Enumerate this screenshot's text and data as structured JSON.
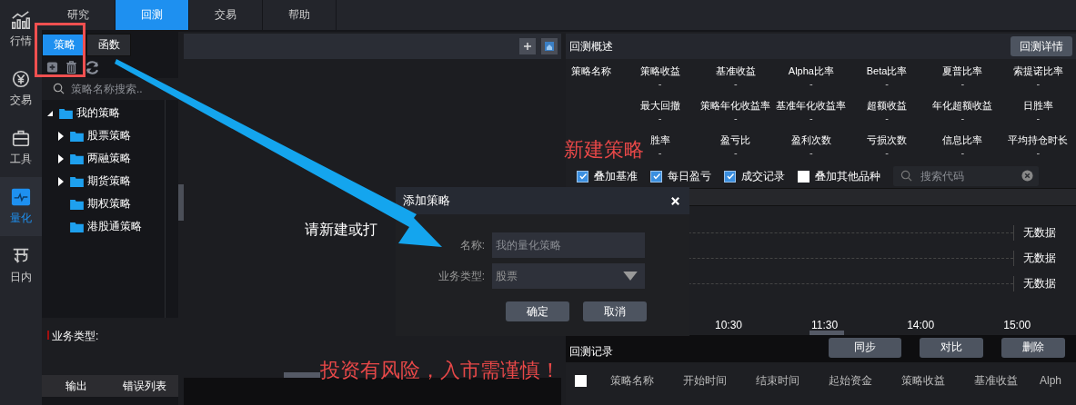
{
  "nav": [
    {
      "label": "行情",
      "selected": false
    },
    {
      "label": "交易",
      "selected": false
    },
    {
      "label": "工具",
      "selected": false
    },
    {
      "label": "量化",
      "selected": true
    },
    {
      "label": "日内",
      "selected": false
    }
  ],
  "tabs": [
    {
      "label": "研究",
      "selected": false
    },
    {
      "label": "回测",
      "selected": true
    },
    {
      "label": "交易",
      "selected": false
    },
    {
      "label": "帮助",
      "selected": false
    }
  ],
  "strategy_panel": {
    "tabs": [
      {
        "label": "策略",
        "selected": true
      },
      {
        "label": "函数",
        "selected": false
      }
    ],
    "search": {
      "placeholder": "策略名称搜索.."
    },
    "tree": [
      {
        "label": "我的策略",
        "expanded": true,
        "children": [
          {
            "label": "股票策略",
            "expanded": false
          },
          {
            "label": "两融策略",
            "expanded": false
          },
          {
            "label": "期货策略",
            "expanded": false
          },
          {
            "label": "期权策略"
          },
          {
            "label": "港股通策略"
          }
        ]
      }
    ],
    "business_type_label": "业务类型:",
    "output_tabs": [
      "输出",
      "错误列表"
    ]
  },
  "center": {
    "message": "请新建或打"
  },
  "overview": {
    "title": "回测概述",
    "detail_button": "回测详情",
    "metrics": [
      [
        {
          "label": "策略名称"
        },
        {
          "label": "策略收益",
          "value": "-"
        },
        {
          "label": "基准收益",
          "value": "-"
        },
        {
          "label": "Alpha比率",
          "value": "-"
        },
        {
          "label": "Beta比率",
          "value": "-"
        },
        {
          "label": "夏普比率",
          "value": "-"
        },
        {
          "label": "索提诺比率",
          "value": "-"
        }
      ],
      [
        {
          "label": "最大回撤",
          "value": "-"
        },
        {
          "label": "策略年化收益率",
          "value": "-"
        },
        {
          "label": "基准年化收益率",
          "value": "-"
        },
        {
          "label": "超额收益",
          "value": "-"
        },
        {
          "label": "年化超额收益",
          "value": "-"
        },
        {
          "label": "日胜率",
          "value": "-"
        }
      ],
      [
        {
          "label": "胜率",
          "value": "-"
        },
        {
          "label": "盈亏比",
          "value": "-"
        },
        {
          "label": "盈利次数",
          "value": "-"
        },
        {
          "label": "亏损次数",
          "value": "-"
        },
        {
          "label": "信息比率",
          "value": "-"
        },
        {
          "label": "平均持仓时长",
          "value": "-"
        }
      ]
    ],
    "options": [
      {
        "label": "叠加基准",
        "checked": true
      },
      {
        "label": "每日盈亏",
        "checked": true
      },
      {
        "label": "成交记录",
        "checked": true
      },
      {
        "label": "叠加其他品种",
        "checked": false
      }
    ],
    "code_search": {
      "placeholder": "搜索代码"
    },
    "chart_labels": [
      "无数据",
      "无数据",
      "无数据"
    ],
    "times": [
      "10:30",
      "11:30",
      "14:00",
      "15:00"
    ]
  },
  "records": {
    "title": "回测记录",
    "all_checked": false,
    "buttons": [
      "同步",
      "对比",
      "删除"
    ],
    "columns": [
      "策略名称",
      "开始时间",
      "结束时间",
      "起始资金",
      "策略收益",
      "基准收益",
      "Alph"
    ]
  },
  "dialog": {
    "title": "添加策略",
    "fields": [
      {
        "label": "名称:",
        "kind": "text",
        "placeholder": "我的量化策略"
      },
      {
        "label": "业务类型:",
        "kind": "select",
        "value": "股票"
      }
    ],
    "buttons": [
      "确定",
      "取消"
    ]
  },
  "annotations": {
    "title": "新建策略",
    "warning": "投资有风险，入市需谨慎！"
  }
}
